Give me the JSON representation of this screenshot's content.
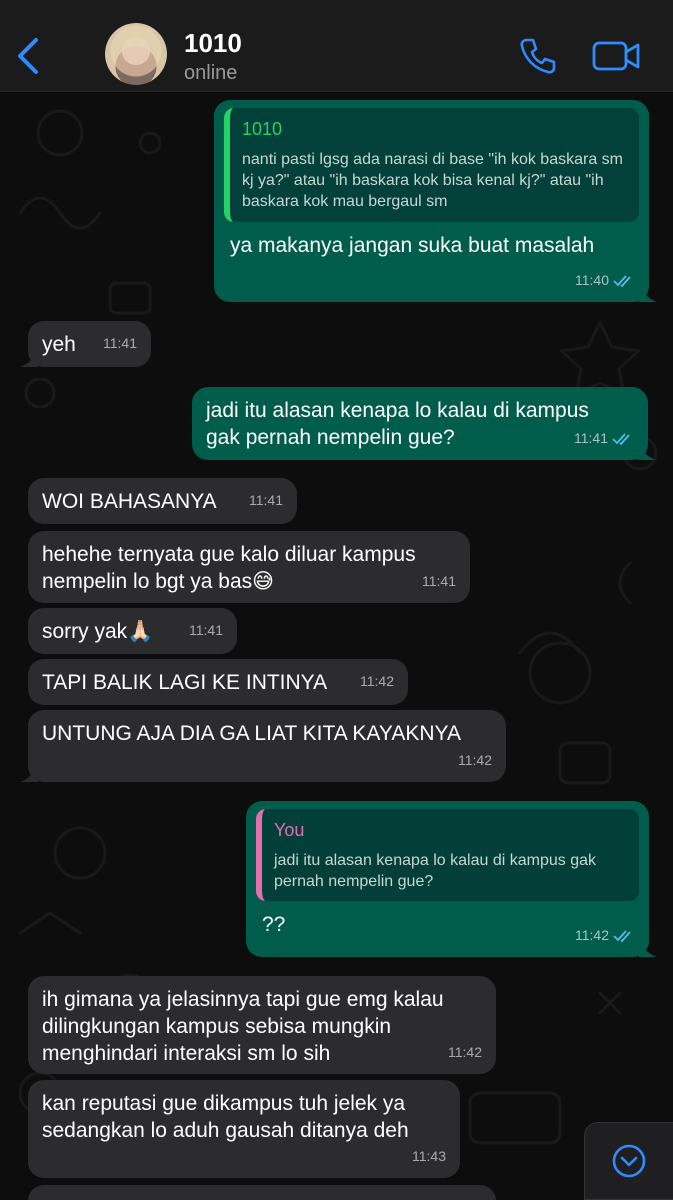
{
  "header": {
    "contact_name": "1010",
    "status": "online",
    "icons": {
      "back": "chevron-left-icon",
      "call": "phone-icon",
      "video": "video-camera-icon"
    },
    "accent_color": "#2f8cff"
  },
  "messages": [
    {
      "direction": "out",
      "quote": {
        "author": "1010",
        "text": "nanti pasti lgsg ada narasi di base \"ih kok baskara sm kj ya?\" atau \"ih baskara kok bisa kenal kj?\" atau \"ih baskara kok mau bergaul sm"
      },
      "text": "ya makanya jangan suka buat masalah",
      "time": "11:40",
      "status": "read"
    },
    {
      "direction": "in",
      "text": "yeh",
      "time": "11:41"
    },
    {
      "direction": "out",
      "text": "jadi itu alasan kenapa lo kalau di kampus gak pernah nempelin gue?",
      "time": "11:41",
      "status": "read"
    },
    {
      "direction": "in",
      "text": "WOI BAHASANYA",
      "time": "11:41"
    },
    {
      "direction": "in",
      "text": "hehehe ternyata gue kalo diluar kampus nempelin lo bgt ya bas😅",
      "time": "11:41"
    },
    {
      "direction": "in",
      "text": "sorry yak🙏🏻",
      "time": "11:41"
    },
    {
      "direction": "in",
      "text": "TAPI BALIK LAGI KE INTINYA",
      "time": "11:42"
    },
    {
      "direction": "in",
      "text": "UNTUNG AJA DIA GA LIAT KITA KAYAKNYA",
      "time": "11:42"
    },
    {
      "direction": "out",
      "quote": {
        "author": "You",
        "text": "jadi itu alasan kenapa lo kalau di kampus gak pernah nempelin gue?"
      },
      "text": "??",
      "time": "11:42",
      "status": "read"
    },
    {
      "direction": "in",
      "text": "ih gimana ya jelasinnya tapi gue emg kalau dilingkungan kampus sebisa mungkin menghindari interaksi sm lo sih",
      "time": "11:42"
    },
    {
      "direction": "in",
      "text": "kan reputasi gue dikampus tuh jelek ya sedangkan lo aduh gausah ditanya deh",
      "time": "11:43"
    }
  ],
  "scroll_button": {
    "icon": "chevron-down-circle-icon"
  }
}
